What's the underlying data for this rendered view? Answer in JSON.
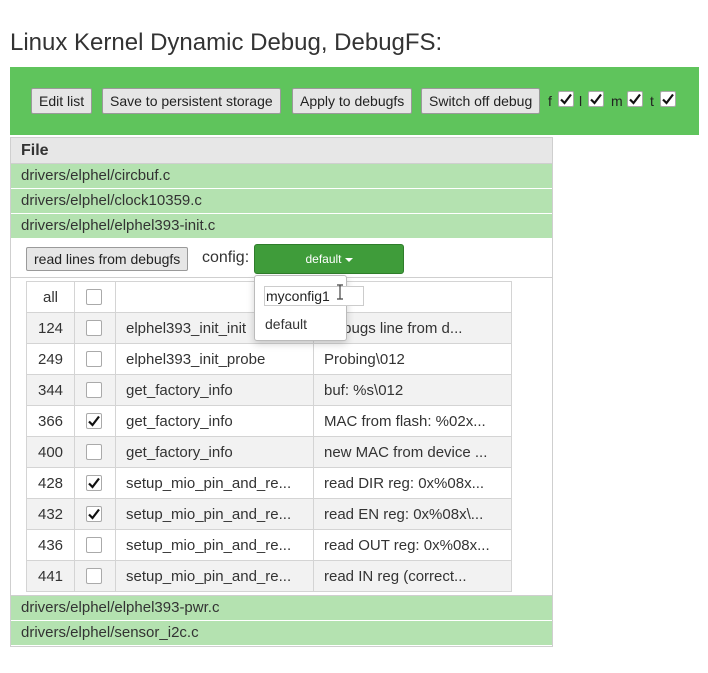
{
  "page": {
    "title": "Linux Kernel Dynamic Debug, DebugFS:"
  },
  "toolbar": {
    "buttons": [
      "Edit list",
      "Save to persistent storage",
      "Apply to debugfs",
      "Switch off debug"
    ],
    "flags": [
      {
        "label": "f",
        "checked": true
      },
      {
        "label": "l",
        "checked": true
      },
      {
        "label": "m",
        "checked": true
      },
      {
        "label": "t",
        "checked": true
      }
    ],
    "accent": "#5fc45c"
  },
  "files": {
    "header": "File",
    "rows": [
      "drivers/elphel/circbuf.c",
      "drivers/elphel/clock10359.c",
      "drivers/elphel/elphel393-init.c"
    ],
    "rows_after": [
      "drivers/elphel/elphel393-pwr.c",
      "drivers/elphel/sensor_i2c.c"
    ]
  },
  "expanded": {
    "read_button": "read lines from debugfs",
    "config_label": "config:",
    "config_value": "default",
    "all_label": "all",
    "lines": [
      {
        "line": "124",
        "checked": false,
        "function": "elphel393_init_init",
        "format": "Debugs line from d..."
      },
      {
        "line": "249",
        "checked": false,
        "function": "elphel393_init_probe",
        "format": "Probing\\012"
      },
      {
        "line": "344",
        "checked": false,
        "function": "get_factory_info",
        "format": "buf: %s\\012"
      },
      {
        "line": "366",
        "checked": true,
        "function": "get_factory_info",
        "format": "MAC from flash: %02x..."
      },
      {
        "line": "400",
        "checked": false,
        "function": "get_factory_info",
        "format": "new MAC from device ..."
      },
      {
        "line": "428",
        "checked": true,
        "function": "setup_mio_pin_and_re...",
        "format": "read DIR reg: 0x%08x..."
      },
      {
        "line": "432",
        "checked": true,
        "function": "setup_mio_pin_and_re...",
        "format": "read EN reg: 0x%08x\\..."
      },
      {
        "line": "436",
        "checked": false,
        "function": "setup_mio_pin_and_re...",
        "format": "read OUT reg: 0x%08x..."
      },
      {
        "line": "441",
        "checked": false,
        "function": "setup_mio_pin_and_re...",
        "format": "read IN reg (correct..."
      }
    ]
  },
  "dropdown": {
    "input_value": "myconfig1",
    "options": [
      "default"
    ]
  }
}
